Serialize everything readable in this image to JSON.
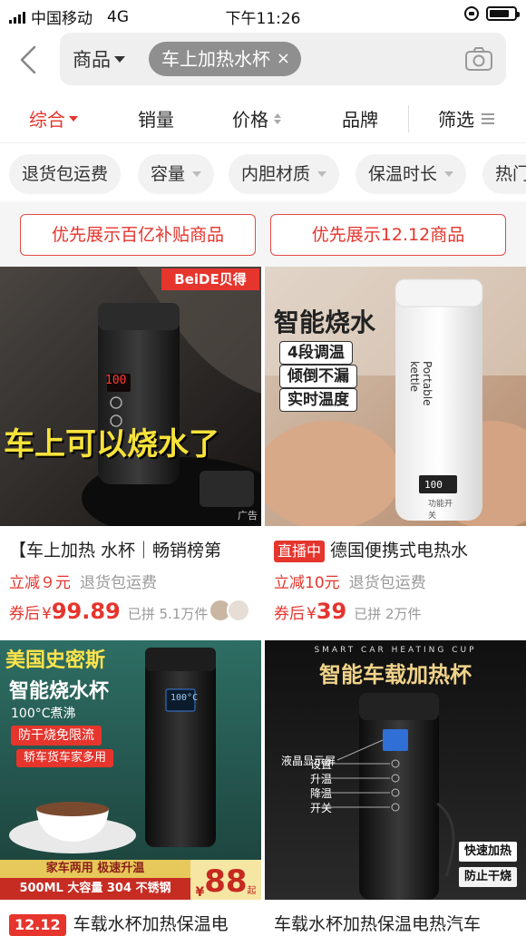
{
  "status_bar": {
    "carrier": "中国移动",
    "network": "4G",
    "time": "下午11:26",
    "battery_level": 0.8
  },
  "search": {
    "scope": "商品",
    "query": "车上加热水杯",
    "clear": "×"
  },
  "sort_tabs": [
    "综合",
    "销量",
    "价格",
    "品牌",
    "筛选"
  ],
  "filters": [
    "退货包运费",
    "容量",
    "内胆材质",
    "保温时长",
    "热门"
  ],
  "promos": [
    "优先展示百亿补贴商品",
    "优先展示12.12商品"
  ],
  "products": [
    {
      "title": "【车上加热 水杯｜畅销榜第",
      "discount": "立减９元",
      "shipping": "退货包运费",
      "price_label": "券后",
      "price": "99.89",
      "sold": "已拼 5.1万件",
      "image_text": {
        "brand": "BeiDE贝得",
        "headline": "车上可以烧水了",
        "display": "100",
        "corner": "广告"
      }
    },
    {
      "live_badge": "直播中",
      "title": "德国便携式电热水",
      "discount": "立减10元",
      "shipping": "退货包运费",
      "price_label": "券后",
      "price": "39",
      "sold": "已拼 2万件",
      "image_text": {
        "headline": "智能烧水",
        "f1": "4段调温",
        "f2": "倾倒不漏",
        "f3": "实时温度",
        "cup_label": "Portable kettle",
        "display": "100",
        "switch": "功能开关"
      }
    },
    {
      "badge": "12.12",
      "title": "车载水杯加热保温电",
      "image_text": {
        "brand": "美国史密斯",
        "headline": "智能烧水杯",
        "sub": "100°C煮沸",
        "r1": "防干烧免限流",
        "r2": "轿车货车家多用",
        "banner1": "家车两用 极速升温",
        "banner2": "500ML 大容量 304 不锈钢",
        "price_tag": "88",
        "yen": "¥",
        "qi": "起",
        "display": "100°C"
      }
    },
    {
      "title": "车载水杯加热保温电热汽车",
      "image_text": {
        "eng": "SMART CAR HEATING CUP",
        "headline": "智能车载加热杯",
        "l1": "液晶显示屏",
        "l2": "设置",
        "l3": "升温",
        "l4": "降温",
        "l5": "开关",
        "t1": "快速加热",
        "t2": "防止干烧"
      }
    }
  ],
  "colors": {
    "accent": "#e5352d",
    "muted": "#999999"
  }
}
